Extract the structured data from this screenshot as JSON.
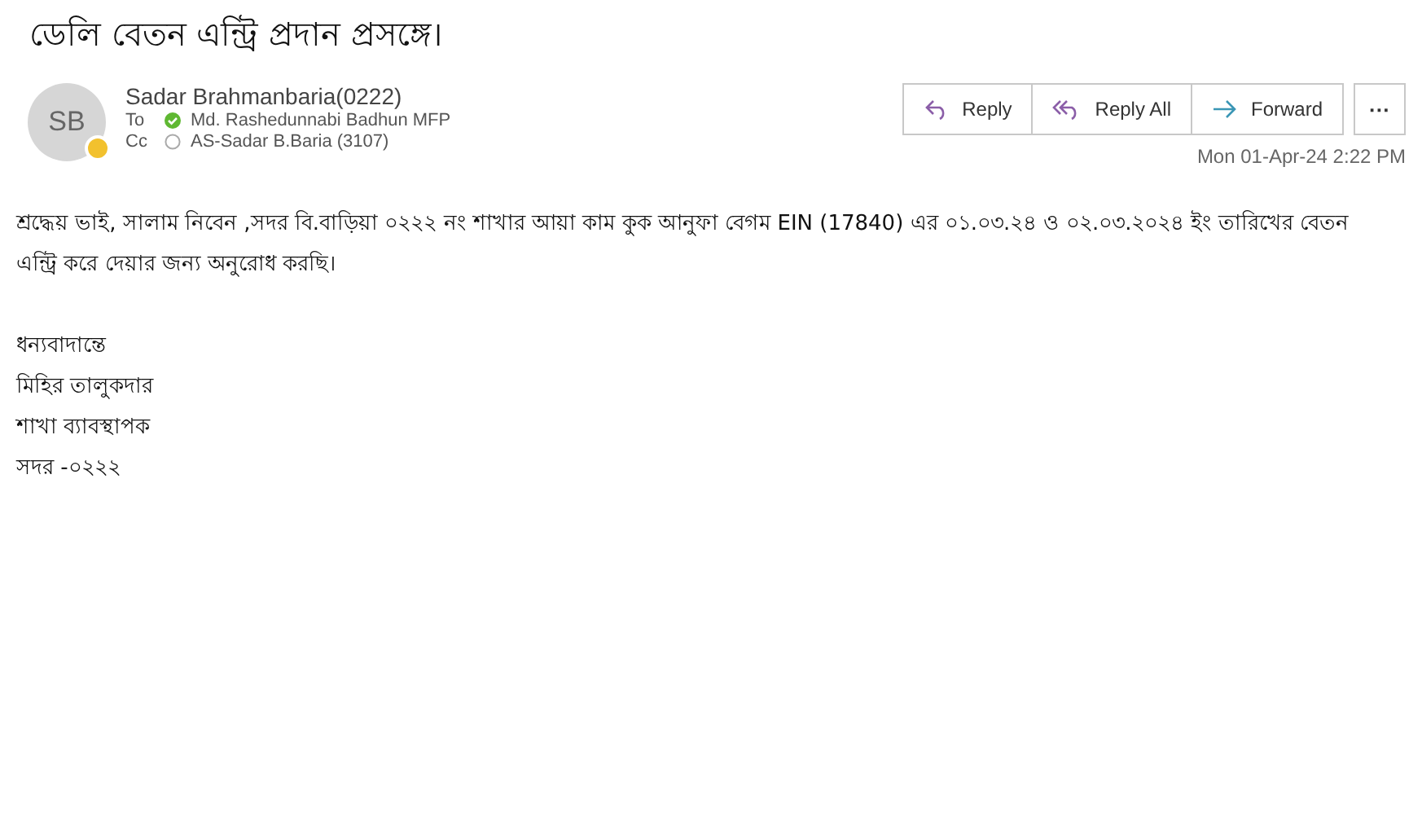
{
  "subject": "ডেলি বেতন এন্ট্রি প্রদান প্রসঙ্গে।",
  "sender": {
    "initials": "SB",
    "name": "Sadar Brahmanbaria(0222)",
    "away": true
  },
  "recipients": [
    {
      "label": "To",
      "name": "Md. Rashedunnabi Badhun MFP",
      "kind": "available"
    },
    {
      "label": "Cc",
      "name": "AS-Sadar B.Baria (3107)",
      "kind": "unknown"
    }
  ],
  "actions": [
    {
      "label": "Reply",
      "kind": "reply"
    },
    {
      "label": "Reply All",
      "kind": "reply-all"
    },
    {
      "label": "Forward",
      "kind": "forward"
    }
  ],
  "more_button": "···",
  "date": "Mon 01-Apr-24 2:22 PM",
  "body": [
    "শ্রদ্ধেয় ভাই, সালাম নিবেন ,সদর বি.বাড়িয়া ০২২২ নং শাখার আয়া কাম কুক আনুফা বেগম EIN  (17840)  এর ০১.০৩.২৪ ও ০২.০৩.২০২৪ ইং তারিখের বেতন এন্ট্রি করে দেয়ার জন্য অনুরোধ করছি।"
  ],
  "signature": [
    "ধন্যবাদান্তে",
    "মিহির তালুকদার",
    "শাখা ব্যাবস্থাপক",
    "সদর -০২২২"
  ]
}
